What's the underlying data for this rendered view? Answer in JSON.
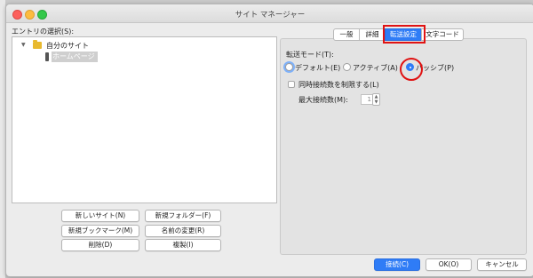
{
  "window": {
    "title": "サイト マネージャー"
  },
  "tree": {
    "label": "エントリの選択(S):",
    "root": "自分のサイト",
    "selected_item": "ホームページ"
  },
  "left_buttons": {
    "new_site": "新しいサイト(N)",
    "new_folder": "新規フォルダー(F)",
    "new_bookmark": "新規ブックマーク(M)",
    "rename": "名前の変更(R)",
    "delete": "削除(D)",
    "duplicate": "複製(I)"
  },
  "tabs": [
    "一般",
    "詳細",
    "転送設定",
    "文字コード"
  ],
  "active_tab": "転送設定",
  "transfer": {
    "mode_label": "転送モード(T):",
    "modes": [
      "デフォルト(E)",
      "アクティブ(A)",
      "パッシブ(P)"
    ],
    "selected_mode": "パッシブ(P)",
    "limit_label": "同時接続数を制限する(L)",
    "limit_checked": false,
    "max_conn_label": "最大接続数(M):",
    "max_conn_value": "1"
  },
  "footer": {
    "connect": "接続(C)",
    "ok": "OK(O)",
    "cancel": "キャンセル"
  },
  "colors": {
    "accent": "#2f7cf6",
    "annotation_red": "#e01313",
    "folder": "#e8b92f"
  }
}
